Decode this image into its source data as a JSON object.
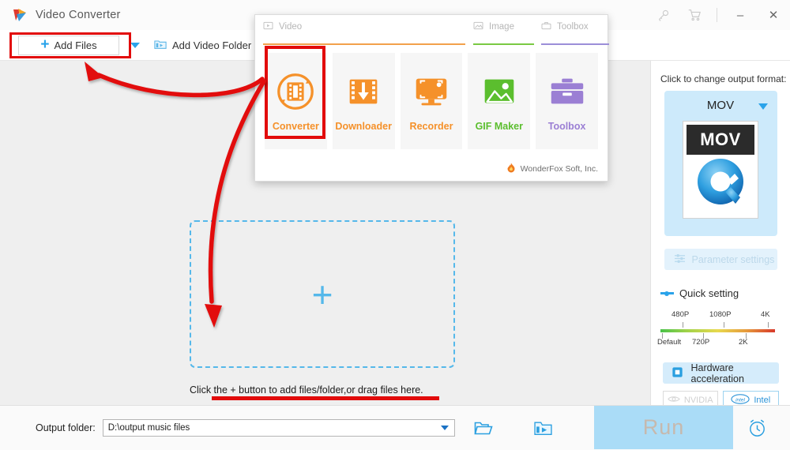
{
  "window": {
    "title": "Video Converter",
    "logo_icon": "wonderfox-play-logo",
    "controls": [
      {
        "name": "key-icon",
        "glyph": "key"
      },
      {
        "name": "cart-icon",
        "glyph": "cart"
      },
      {
        "name": "minimize-button",
        "glyph": "–"
      },
      {
        "name": "close-button",
        "glyph": "✕"
      }
    ]
  },
  "toolbar": {
    "add_files_label": "Add Files",
    "add_files_icon": "plus-icon",
    "dropdown_icon": "caret-down-icon",
    "add_video_folder_label": "Add Video Folder",
    "add_video_folder_icon": "folder-video-icon"
  },
  "dropzone": {
    "plus_glyph": "+",
    "hint": "Click the + button to add files/folder,or drag files here."
  },
  "popup": {
    "tabs": [
      {
        "label": "Video",
        "icon": "video-icon",
        "color": "#f2a14b"
      },
      {
        "label": "Image",
        "icon": "image-icon",
        "color": "#7ac943"
      },
      {
        "label": "Toolbox",
        "icon": "toolbox-icon",
        "color": "#9b8ed8"
      }
    ],
    "cards": [
      {
        "label": "Converter",
        "icon": "converter-icon",
        "color": "#f5912a",
        "selected": true
      },
      {
        "label": "Downloader",
        "icon": "downloader-icon",
        "color": "#f5912a",
        "selected": false
      },
      {
        "label": "Recorder",
        "icon": "recorder-icon",
        "color": "#f5912a",
        "selected": false
      },
      {
        "label": "GIF Maker",
        "icon": "gif-maker-icon",
        "color": "#5bbe2e",
        "selected": false
      },
      {
        "label": "Toolbox",
        "icon": "toolbox-case-icon",
        "color": "#9b7fd4",
        "selected": false
      }
    ],
    "footer": "WonderFox Soft, Inc.",
    "footer_icon": "flame-icon"
  },
  "right_panel": {
    "output_format_label": "Click to change output format:",
    "format_name": "MOV",
    "format_thumb_text": "MOV",
    "format_caret_icon": "caret-down-icon",
    "parameter_settings_label": "Parameter settings",
    "parameter_settings_icon": "sliders-icon",
    "quick_setting_label": "Quick setting",
    "quick_setting_icon": "slider-handle-icon",
    "quality_ticks_top": [
      "480P",
      "1080P",
      "4K"
    ],
    "quality_ticks_bottom": [
      "Default",
      "720P",
      "2K"
    ],
    "hardware_acceleration_label": "Hardware acceleration",
    "hardware_acceleration_icon": "chip-icon",
    "gpu_buttons": [
      {
        "label": "NVIDIA",
        "icon": "nvidia-icon",
        "enabled": false
      },
      {
        "label": "Intel",
        "icon": "intel-icon",
        "enabled": true
      }
    ]
  },
  "bottom_bar": {
    "output_folder_label": "Output folder:",
    "output_folder_value": "D:\\output music files",
    "output_folder_caret_icon": "caret-down-icon",
    "open_folder_icon": "folder-open-icon",
    "video_folder_icon": "folder-video-icon",
    "run_label": "Run",
    "alarm_icon": "alarm-clock-icon"
  },
  "annotations": {
    "highlight_color": "#e20b0b",
    "boxes": [
      "add-files-button",
      "converter-card"
    ],
    "underline_target": "dropzone-hint"
  }
}
